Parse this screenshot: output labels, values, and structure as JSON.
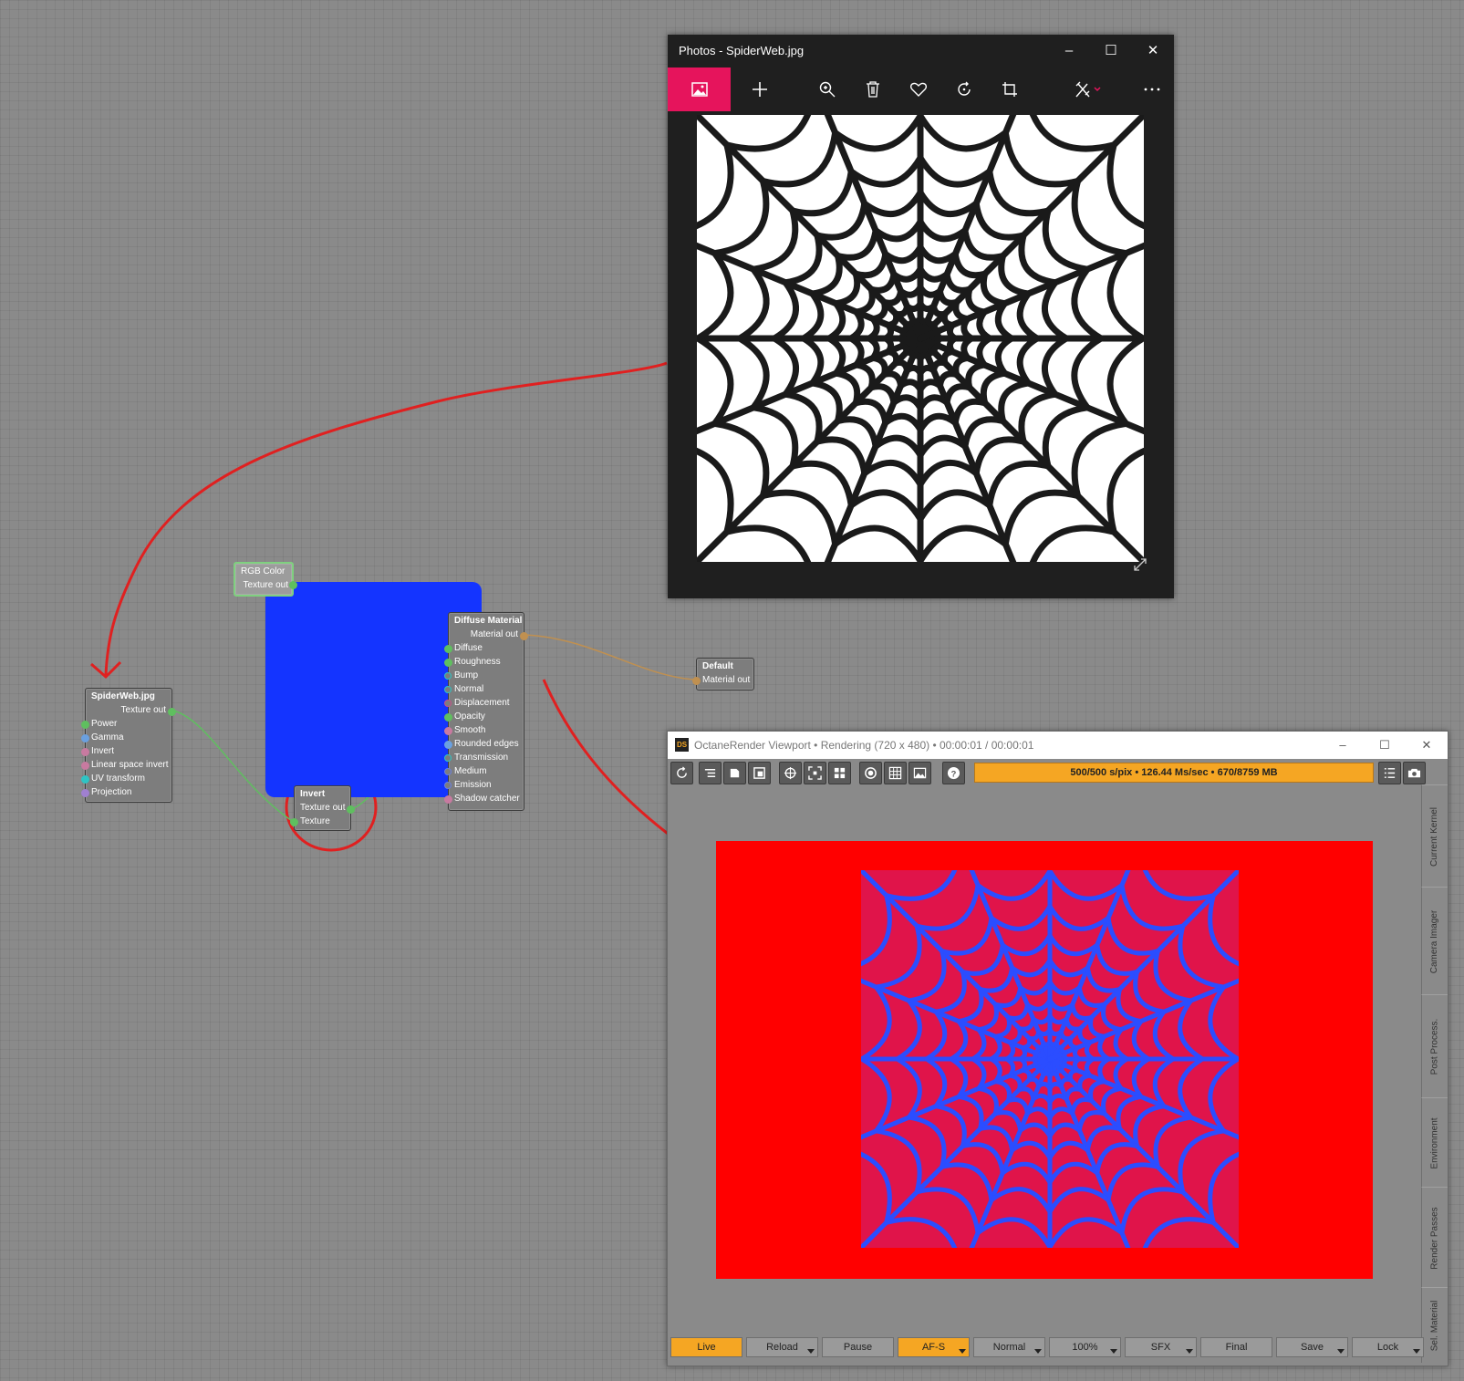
{
  "nodes": {
    "spiderweb": {
      "title": "SpiderWeb.jpg",
      "output": "Texture out",
      "inputs": [
        "Power",
        "Gamma",
        "Invert",
        "Linear space invert",
        "UV transform",
        "Projection"
      ]
    },
    "rgb_color": {
      "title": "RGB Color",
      "output": "Texture out",
      "color": "#1434ff"
    },
    "invert": {
      "title": "Invert",
      "output": "Texture out",
      "inputs": [
        "Texture"
      ]
    },
    "diffuse": {
      "title": "Diffuse Material",
      "output": "Material out",
      "inputs": [
        "Diffuse",
        "Roughness",
        "Bump",
        "Normal",
        "Displacement",
        "Opacity",
        "Smooth",
        "Rounded edges",
        "Transmission",
        "Medium",
        "Emission",
        "Shadow catcher"
      ]
    },
    "default": {
      "title": "Default",
      "output": "Material out"
    }
  },
  "photos_window": {
    "title": "Photos - SpiderWeb.jpg",
    "accent": "#e6145c",
    "toolbar_icons": [
      "image-icon",
      "add-icon",
      "zoom-icon",
      "delete-icon",
      "heart-icon",
      "rotate-icon",
      "crop-icon",
      "edit-icon",
      "more-icon"
    ]
  },
  "octane_window": {
    "app_badge": "DS",
    "title": "OctaneRender Viewport • Rendering (720 x 480) • 00:00:01 / 00:00:01",
    "status": "500/500 s/pix • 126.44 Ms/sec • 670/8759 MB",
    "side_tabs": [
      "Current Kernel",
      "Camera Imager",
      "Post Process.",
      "Environment",
      "Render Passes",
      "Sel. Material"
    ],
    "bottom_buttons": [
      {
        "label": "Live",
        "active": true,
        "menu": false
      },
      {
        "label": "Reload",
        "active": false,
        "menu": true
      },
      {
        "label": "Pause",
        "active": false,
        "menu": false
      },
      {
        "label": "AF-S",
        "active": true,
        "menu": true
      },
      {
        "label": "Normal",
        "active": false,
        "menu": true
      },
      {
        "label": "100%",
        "active": false,
        "menu": true
      },
      {
        "label": "SFX",
        "active": false,
        "menu": true
      },
      {
        "label": "Final",
        "active": false,
        "menu": false
      },
      {
        "label": "Save",
        "active": false,
        "menu": true
      },
      {
        "label": "Lock",
        "active": false,
        "menu": true
      }
    ],
    "render_background": "#ff0000",
    "web_color": "#2b4dff",
    "web_fill": "#e0144a"
  },
  "window_controls": {
    "minimize": "–",
    "maximize": "☐",
    "close": "✕"
  }
}
